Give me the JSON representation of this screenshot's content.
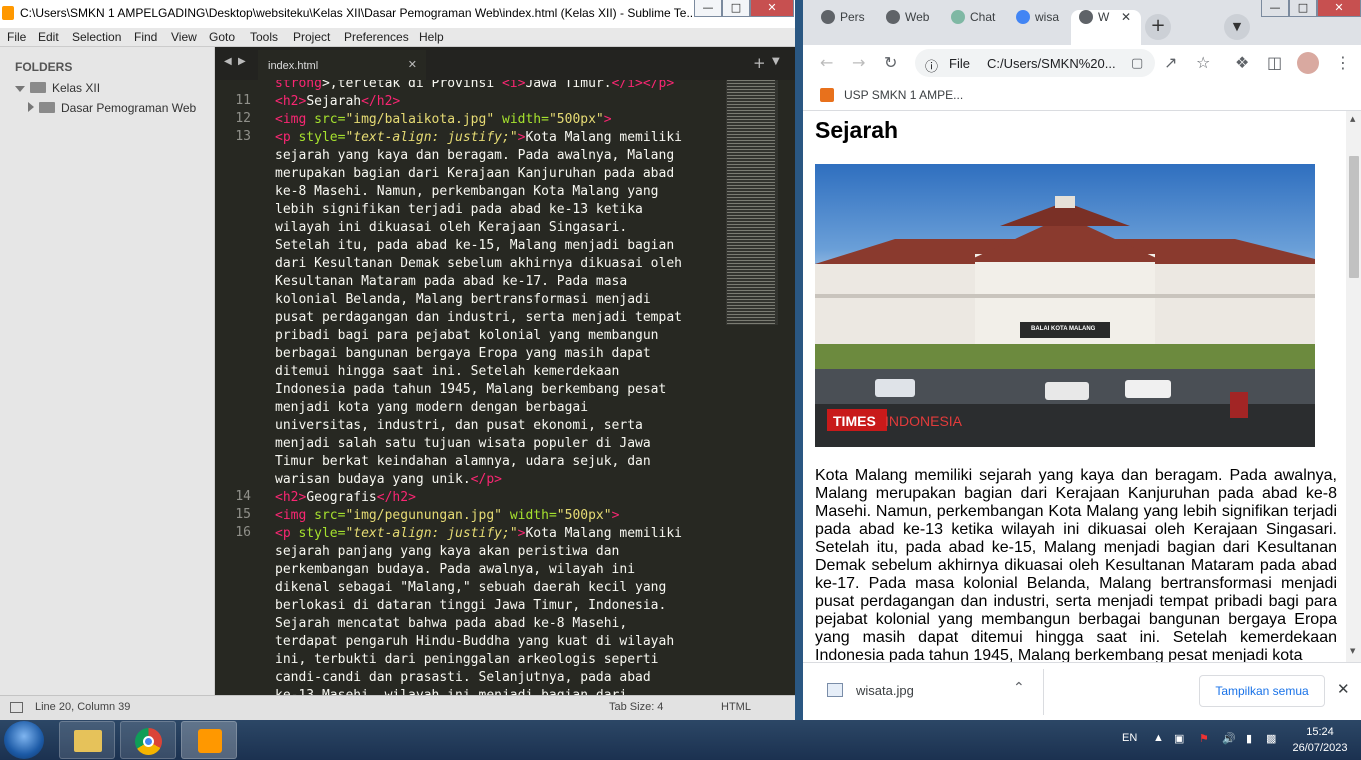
{
  "sublime": {
    "title": "C:\\Users\\SMKN 1 AMPELGADING\\Desktop\\websiteku\\Kelas XII\\Dasar Pemograman Web\\index.html (Kelas XII) - Sublime Te...",
    "menu": [
      "File",
      "Edit",
      "Selection",
      "Find",
      "View",
      "Goto",
      "Tools",
      "Project",
      "Preferences",
      "Help"
    ],
    "folders_heading": "FOLDERS",
    "folder_root": "Kelas XII",
    "folder_child": "Dasar Pemograman Web",
    "tab_label": "index.html",
    "line_numbers": [
      "11",
      "12",
      "13",
      "14",
      "15",
      "16"
    ],
    "status_position": "Line 20, Column 39",
    "status_tabsize": "Tab Size: 4",
    "status_syntax": "HTML"
  },
  "code": {
    "l0_tag1": "strong",
    "l0_text": ">,terletak di Provinsi ",
    "l0_tag2": "<i>",
    "l0_mid": "Jawa Timur.",
    "l0_tag3": "</i></p>",
    "l11_open": "<h2>",
    "l11_text": "Sejarah",
    "l11_close": "</h2>",
    "l12_tag": "<img",
    "l12_attr1": " src=",
    "l12_val1": "\"img/balaikota.jpg\"",
    "l12_attr2": " width=",
    "l12_val2": "\"500px\"",
    "l12_end": ">",
    "l13_tag": "<p",
    "l13_attr": " style=",
    "l13_val": "\"text-align: justify;\"",
    "l13_end": ">",
    "l13_first": "Kota Malang memiliki",
    "l13_wrap": [
      "sejarah yang kaya dan beragam. Pada awalnya, Malang",
      "merupakan bagian dari Kerajaan Kanjuruhan pada abad",
      "ke-8 Masehi. Namun, perkembangan Kota Malang yang",
      "lebih signifikan terjadi pada abad ke-13 ketika",
      "wilayah ini dikuasai oleh Kerajaan Singasari.",
      "Setelah itu, pada abad ke-15, Malang menjadi bagian",
      "dari Kesultanan Demak sebelum akhirnya dikuasai oleh",
      "Kesultanan Mataram pada abad ke-17. Pada masa",
      "kolonial Belanda, Malang bertransformasi menjadi",
      "pusat perdagangan dan industri, serta menjadi tempat",
      "pribadi bagi para pejabat kolonial yang membangun",
      "berbagai bangunan bergaya Eropa yang masih dapat",
      "ditemui hingga saat ini. Setelah kemerdekaan",
      "Indonesia pada tahun 1945, Malang berkembang pesat",
      "menjadi kota yang modern dengan berbagai",
      "universitas, industri, dan pusat ekonomi, serta",
      "menjadi salah satu tujuan wisata populer di Jawa",
      "Timur berkat keindahan alamnya, udara sejuk, dan"
    ],
    "l13_last": "warisan budaya yang unik.",
    "l13_close": "</p>",
    "l14_open": "<h2>",
    "l14_text": "Geografis",
    "l14_close": "</h2>",
    "l15_val1": "\"img/pegunungan.jpg\"",
    "l16_first": "Kota Malang memiliki",
    "l16_wrap": [
      "sejarah panjang yang kaya akan peristiwa dan",
      "perkembangan budaya. Pada awalnya, wilayah ini",
      "dikenal sebagai \"Malang,\" sebuah daerah kecil yang",
      "berlokasi di dataran tinggi Jawa Timur, Indonesia.",
      "Sejarah mencatat bahwa pada abad ke-8 Masehi,",
      "terdapat pengaruh Hindu-Buddha yang kuat di wilayah",
      "ini, terbukti dari peninggalan arkeologis seperti",
      "candi-candi dan prasasti. Selanjutnya, pada abad",
      "ke-13 Masehi, wilayah ini menjadi bagian dari"
    ]
  },
  "chrome": {
    "tabs": [
      "Pers",
      "Web",
      "Chat",
      "wisa",
      "W"
    ],
    "url_prefix": "File",
    "url": "C:/Users/SMKN%20...",
    "bookmark": "USP SMKN 1 AMPE...",
    "heading": "Sejarah",
    "photo_sign": "BALAI KOTA MALANG",
    "photo_watermark_a": "TIMES",
    "photo_watermark_b": "INDONESIA",
    "paragraph": "Kota Malang memiliki sejarah yang kaya dan beragam. Pada awalnya, Malang merupakan bagian dari Kerajaan Kanjuruhan pada abad ke-8 Masehi. Namun, perkembangan Kota Malang yang lebih signifikan terjadi pada abad ke-13 ketika wilayah ini dikuasai oleh Kerajaan Singasari. Setelah itu, pada abad ke-15, Malang menjadi bagian dari Kesultanan Demak sebelum akhirnya dikuasai oleh Kesultanan Mataram pada abad ke-17. Pada masa kolonial Belanda, Malang bertransformasi menjadi pusat perdagangan dan industri, serta menjadi tempat pribadi bagi para pejabat kolonial yang membangun berbagai bangunan bergaya Eropa yang masih dapat ditemui hingga saat ini. Setelah kemerdekaan Indonesia pada tahun 1945, Malang berkembang pesat menjadi kota",
    "download_file": "wisata.jpg",
    "show_all": "Tampilkan semua"
  },
  "taskbar": {
    "lang": "EN",
    "time": "15:24",
    "date": "26/07/2023"
  }
}
